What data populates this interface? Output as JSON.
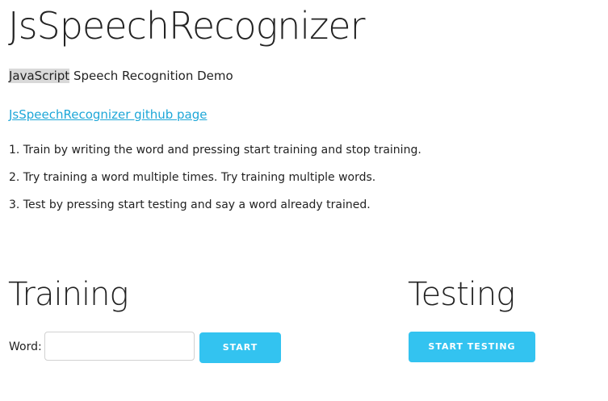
{
  "header": {
    "title": "JsSpeechRecognizer",
    "subtitle_highlight": "JavaScript",
    "subtitle_rest": " Speech Recognition Demo",
    "github_link": "JsSpeechRecognizer github page"
  },
  "instructions": [
    "1. Train by writing the word and pressing start training and stop training.",
    "2. Try training a word multiple times. Try training multiple words.",
    "3. Test by pressing start testing and say a word already trained."
  ],
  "training": {
    "heading": "Training",
    "word_label": "Word:",
    "word_value": "",
    "start_button": "Start"
  },
  "testing": {
    "heading": "Testing",
    "start_testing_button": "Start Testing"
  },
  "colors": {
    "accent": "#33c3f0",
    "link": "#1ea7d8",
    "highlight": "#d9d9d9"
  }
}
